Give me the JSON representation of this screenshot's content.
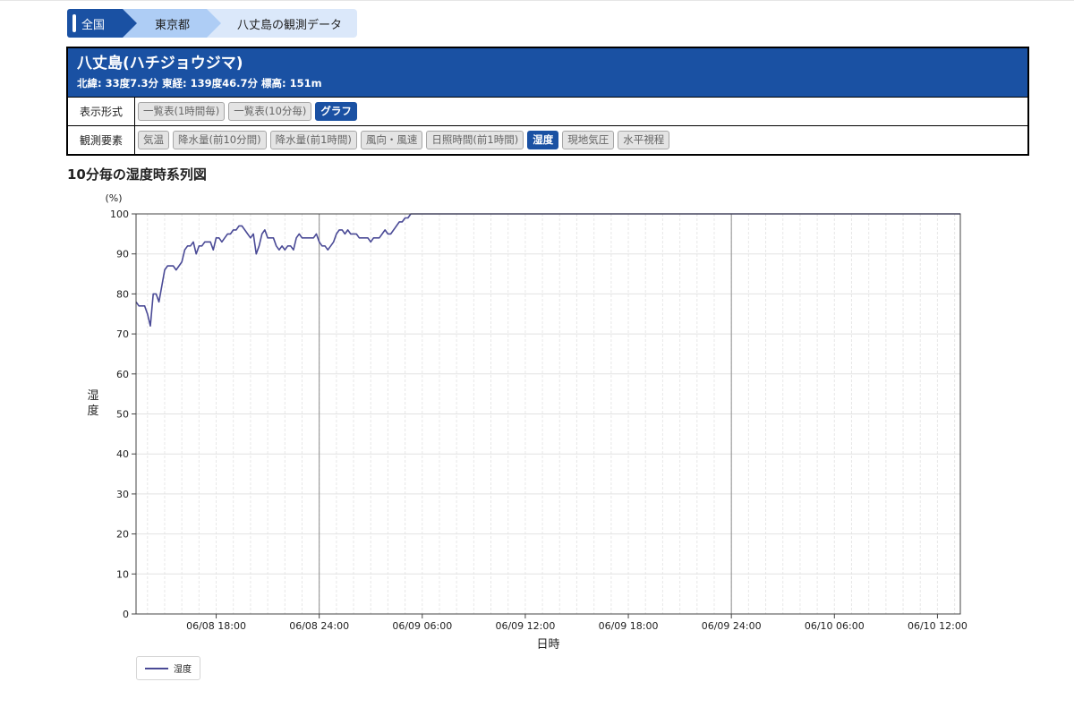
{
  "breadcrumb": {
    "items": [
      "全国",
      "東京都",
      "八丈島の観測データ"
    ]
  },
  "station": {
    "name": "八丈島(ハチジョウジマ)",
    "location": "北緯: 33度7.3分 東経: 139度46.7分 標高: 151m"
  },
  "display_format": {
    "label": "表示形式",
    "options": [
      "一覧表(1時間毎)",
      "一覧表(10分毎)",
      "グラフ"
    ],
    "active": "グラフ"
  },
  "elements": {
    "label": "観測要素",
    "options": [
      "気温",
      "降水量(前10分間)",
      "降水量(前1時間)",
      "風向・風速",
      "日照時間(前1時間)",
      "湿度",
      "現地気圧",
      "水平視程"
    ],
    "active": "湿度"
  },
  "colors": {
    "accent": "#1a51a3",
    "series": "#4a4a96"
  },
  "chart_data": {
    "type": "line",
    "title": "10分毎の湿度時系列図",
    "xlabel": "日時",
    "ylabel": "湿度",
    "yunit": "(%)",
    "ylim": [
      0,
      100
    ],
    "yticks": [
      0,
      10,
      20,
      30,
      40,
      50,
      60,
      70,
      80,
      90,
      100
    ],
    "xlim": [
      "2024-06-08T13:20",
      "2024-06-10T13:20"
    ],
    "xticks": [
      {
        "t": "2024-06-08T18:00",
        "label": "06/08 18:00"
      },
      {
        "t": "2024-06-09T00:00",
        "label": "06/08 24:00"
      },
      {
        "t": "2024-06-09T06:00",
        "label": "06/09 06:00"
      },
      {
        "t": "2024-06-09T12:00",
        "label": "06/09 12:00"
      },
      {
        "t": "2024-06-09T18:00",
        "label": "06/09 18:00"
      },
      {
        "t": "2024-06-10T00:00",
        "label": "06/09 24:00"
      },
      {
        "t": "2024-06-10T06:00",
        "label": "06/10 06:00"
      },
      {
        "t": "2024-06-10T12:00",
        "label": "06/10 12:00"
      }
    ],
    "grid": true,
    "legend_position": "bottom-left",
    "series": [
      {
        "name": "湿度",
        "color": "#4a4a96",
        "points": [
          [
            "2024-06-08T13:20",
            78
          ],
          [
            "2024-06-08T13:30",
            77
          ],
          [
            "2024-06-08T13:40",
            77
          ],
          [
            "2024-06-08T13:50",
            77
          ],
          [
            "2024-06-08T14:00",
            75
          ],
          [
            "2024-06-08T14:10",
            72
          ],
          [
            "2024-06-08T14:20",
            80
          ],
          [
            "2024-06-08T14:30",
            80
          ],
          [
            "2024-06-08T14:40",
            78
          ],
          [
            "2024-06-08T14:50",
            82
          ],
          [
            "2024-06-08T15:00",
            86
          ],
          [
            "2024-06-08T15:10",
            87
          ],
          [
            "2024-06-08T15:20",
            87
          ],
          [
            "2024-06-08T15:30",
            87
          ],
          [
            "2024-06-08T15:40",
            86
          ],
          [
            "2024-06-08T15:50",
            87
          ],
          [
            "2024-06-08T16:00",
            88
          ],
          [
            "2024-06-08T16:10",
            91
          ],
          [
            "2024-06-08T16:20",
            92
          ],
          [
            "2024-06-08T16:30",
            92
          ],
          [
            "2024-06-08T16:40",
            93
          ],
          [
            "2024-06-08T16:50",
            90
          ],
          [
            "2024-06-08T17:00",
            92
          ],
          [
            "2024-06-08T17:10",
            92
          ],
          [
            "2024-06-08T17:20",
            93
          ],
          [
            "2024-06-08T17:30",
            93
          ],
          [
            "2024-06-08T17:40",
            93
          ],
          [
            "2024-06-08T17:50",
            91
          ],
          [
            "2024-06-08T18:00",
            94
          ],
          [
            "2024-06-08T18:10",
            94
          ],
          [
            "2024-06-08T18:20",
            93
          ],
          [
            "2024-06-08T18:30",
            94
          ],
          [
            "2024-06-08T18:40",
            95
          ],
          [
            "2024-06-08T18:50",
            95
          ],
          [
            "2024-06-08T19:00",
            96
          ],
          [
            "2024-06-08T19:10",
            96
          ],
          [
            "2024-06-08T19:20",
            97
          ],
          [
            "2024-06-08T19:30",
            97
          ],
          [
            "2024-06-08T19:40",
            96
          ],
          [
            "2024-06-08T19:50",
            95
          ],
          [
            "2024-06-08T20:00",
            94
          ],
          [
            "2024-06-08T20:10",
            95
          ],
          [
            "2024-06-08T20:20",
            90
          ],
          [
            "2024-06-08T20:30",
            92
          ],
          [
            "2024-06-08T20:40",
            95
          ],
          [
            "2024-06-08T20:50",
            96
          ],
          [
            "2024-06-08T21:00",
            94
          ],
          [
            "2024-06-08T21:10",
            94
          ],
          [
            "2024-06-08T21:20",
            94
          ],
          [
            "2024-06-08T21:30",
            92
          ],
          [
            "2024-06-08T21:40",
            91
          ],
          [
            "2024-06-08T21:50",
            92
          ],
          [
            "2024-06-08T22:00",
            91
          ],
          [
            "2024-06-08T22:10",
            92
          ],
          [
            "2024-06-08T22:20",
            92
          ],
          [
            "2024-06-08T22:30",
            91
          ],
          [
            "2024-06-08T22:40",
            94
          ],
          [
            "2024-06-08T22:50",
            95
          ],
          [
            "2024-06-08T23:00",
            94
          ],
          [
            "2024-06-08T23:10",
            94
          ],
          [
            "2024-06-08T23:20",
            94
          ],
          [
            "2024-06-08T23:30",
            94
          ],
          [
            "2024-06-08T23:40",
            94
          ],
          [
            "2024-06-08T23:50",
            95
          ],
          [
            "2024-06-09T00:00",
            93
          ],
          [
            "2024-06-09T00:10",
            92
          ],
          [
            "2024-06-09T00:20",
            92
          ],
          [
            "2024-06-09T00:30",
            91
          ],
          [
            "2024-06-09T00:40",
            92
          ],
          [
            "2024-06-09T00:50",
            93
          ],
          [
            "2024-06-09T01:00",
            95
          ],
          [
            "2024-06-09T01:10",
            96
          ],
          [
            "2024-06-09T01:20",
            96
          ],
          [
            "2024-06-09T01:30",
            95
          ],
          [
            "2024-06-09T01:40",
            96
          ],
          [
            "2024-06-09T01:50",
            95
          ],
          [
            "2024-06-09T02:00",
            95
          ],
          [
            "2024-06-09T02:10",
            95
          ],
          [
            "2024-06-09T02:20",
            94
          ],
          [
            "2024-06-09T02:30",
            94
          ],
          [
            "2024-06-09T02:40",
            94
          ],
          [
            "2024-06-09T02:50",
            94
          ],
          [
            "2024-06-09T03:00",
            93
          ],
          [
            "2024-06-09T03:10",
            94
          ],
          [
            "2024-06-09T03:20",
            94
          ],
          [
            "2024-06-09T03:30",
            94
          ],
          [
            "2024-06-09T03:40",
            95
          ],
          [
            "2024-06-09T03:50",
            96
          ],
          [
            "2024-06-09T04:00",
            95
          ],
          [
            "2024-06-09T04:10",
            95
          ],
          [
            "2024-06-09T04:20",
            96
          ],
          [
            "2024-06-09T04:30",
            97
          ],
          [
            "2024-06-09T04:40",
            98
          ],
          [
            "2024-06-09T04:50",
            98
          ],
          [
            "2024-06-09T05:00",
            99
          ],
          [
            "2024-06-09T05:10",
            99
          ],
          [
            "2024-06-09T05:20",
            100
          ],
          [
            "2024-06-10T13:20",
            100
          ]
        ]
      }
    ]
  }
}
